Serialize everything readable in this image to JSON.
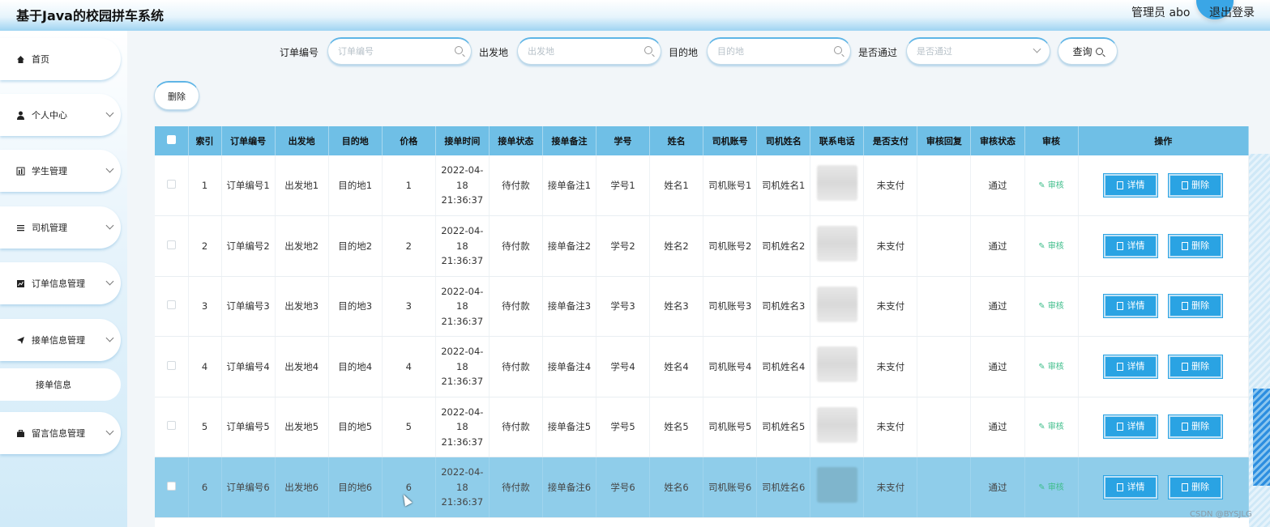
{
  "header": {
    "title": "基于Java的校园拼车系统",
    "user": "管理员 abo",
    "logout": "退出登录"
  },
  "sidebar": {
    "items": [
      {
        "label": "首页",
        "icon": "home-icon"
      },
      {
        "label": "个人中心",
        "icon": "user-icon"
      },
      {
        "label": "学生管理",
        "icon": "chart-icon"
      },
      {
        "label": "司机管理",
        "icon": "list-icon"
      },
      {
        "label": "订单信息管理",
        "icon": "trend-icon"
      },
      {
        "label": "接单信息管理",
        "icon": "send-icon"
      },
      {
        "label": "留言信息管理",
        "icon": "briefcase-icon"
      }
    ],
    "submenu": {
      "label": "接单信息"
    }
  },
  "search": {
    "order_no_label": "订单编号",
    "order_no_placeholder": "订单编号",
    "origin_label": "出发地",
    "origin_placeholder": "出发地",
    "destination_label": "目的地",
    "destination_placeholder": "目的地",
    "approved_label": "是否通过",
    "approved_placeholder": "是否通过",
    "query_label": "查询"
  },
  "toolbar": {
    "delete_label": "删除"
  },
  "table": {
    "headers": [
      "索引",
      "订单编号",
      "出发地",
      "目的地",
      "价格",
      "接单时间",
      "接单状态",
      "接单备注",
      "学号",
      "姓名",
      "司机账号",
      "司机姓名",
      "联系电话",
      "是否支付",
      "审核回复",
      "审核状态",
      "审核",
      "操作"
    ],
    "audit_label": "审核",
    "detail_label": "详情",
    "delete_label": "删除",
    "rows": [
      {
        "index": "1",
        "order_no": "订单编号1",
        "origin": "出发地1",
        "destination": "目的地1",
        "price": "1",
        "time": "2022-04-18 21:36:37",
        "status": "待付款",
        "remark": "接单备注1",
        "student_no": "学号1",
        "name": "姓名1",
        "driver_account": "司机账号1",
        "driver_name": "司机姓名1",
        "paid": "未支付",
        "reply": "",
        "audit_status": "通过"
      },
      {
        "index": "2",
        "order_no": "订单编号2",
        "origin": "出发地2",
        "destination": "目的地2",
        "price": "2",
        "time": "2022-04-18 21:36:37",
        "status": "待付款",
        "remark": "接单备注2",
        "student_no": "学号2",
        "name": "姓名2",
        "driver_account": "司机账号2",
        "driver_name": "司机姓名2",
        "paid": "未支付",
        "reply": "",
        "audit_status": "通过"
      },
      {
        "index": "3",
        "order_no": "订单编号3",
        "origin": "出发地3",
        "destination": "目的地3",
        "price": "3",
        "time": "2022-04-18 21:36:37",
        "status": "待付款",
        "remark": "接单备注3",
        "student_no": "学号3",
        "name": "姓名3",
        "driver_account": "司机账号3",
        "driver_name": "司机姓名3",
        "paid": "未支付",
        "reply": "",
        "audit_status": "通过"
      },
      {
        "index": "4",
        "order_no": "订单编号4",
        "origin": "出发地4",
        "destination": "目的地4",
        "price": "4",
        "time": "2022-04-18 21:36:37",
        "status": "待付款",
        "remark": "接单备注4",
        "student_no": "学号4",
        "name": "姓名4",
        "driver_account": "司机账号4",
        "driver_name": "司机姓名4",
        "paid": "未支付",
        "reply": "",
        "audit_status": "通过"
      },
      {
        "index": "5",
        "order_no": "订单编号5",
        "origin": "出发地5",
        "destination": "目的地5",
        "price": "5",
        "time": "2022-04-18 21:36:37",
        "status": "待付款",
        "remark": "接单备注5",
        "student_no": "学号5",
        "name": "姓名5",
        "driver_account": "司机账号5",
        "driver_name": "司机姓名5",
        "paid": "未支付",
        "reply": "",
        "audit_status": "通过"
      },
      {
        "index": "6",
        "order_no": "订单编号6",
        "origin": "出发地6",
        "destination": "目的地6",
        "price": "6",
        "time": "2022-04-18 21:36:37",
        "status": "待付款",
        "remark": "接单备注6",
        "student_no": "学号6",
        "name": "姓名6",
        "driver_account": "司机账号6",
        "driver_name": "司机姓名6",
        "paid": "未支付",
        "reply": "",
        "audit_status": "通过"
      }
    ]
  },
  "watermark": "CSDN @BYSJLG",
  "colors": {
    "accent": "#2aa3e3",
    "header_row": "#6fbfe6",
    "highlight_row": "#8fcdea",
    "audit_link": "#3dbd8a"
  }
}
